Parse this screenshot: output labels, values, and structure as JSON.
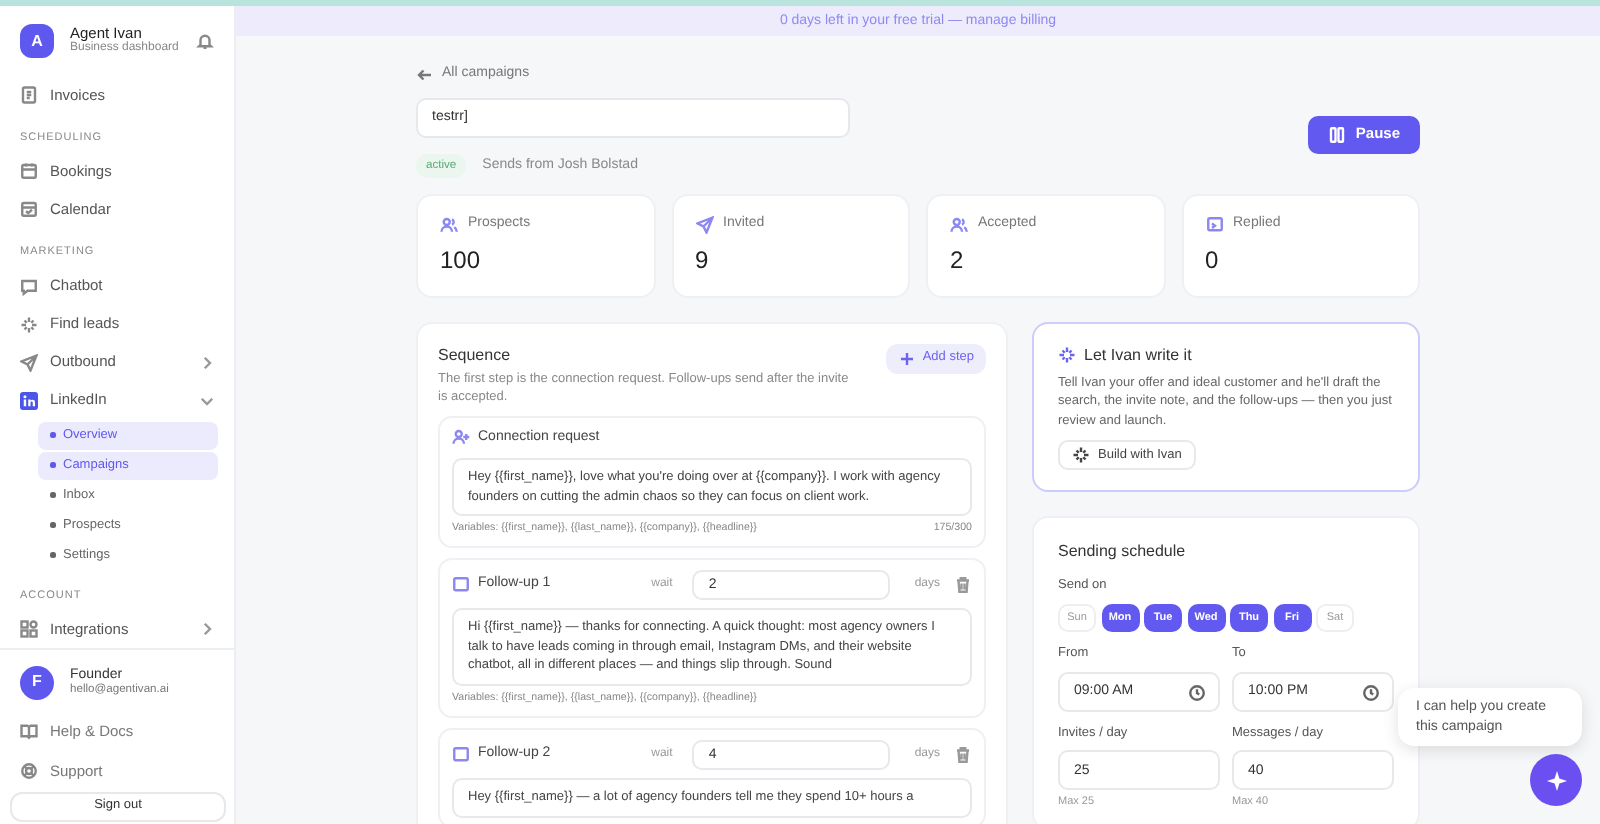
{
  "brand": {
    "avatar": "A",
    "name": "Agent Ivan",
    "subtitle": "Business dashboard"
  },
  "nav": [
    {
      "kind": "item",
      "label": "Invoices"
    },
    {
      "kind": "heading",
      "label": "SCHEDULING"
    },
    {
      "kind": "item",
      "label": "Bookings"
    },
    {
      "kind": "item",
      "label": "Calendar"
    },
    {
      "kind": "heading",
      "label": "MARKETING"
    },
    {
      "kind": "item",
      "label": "Chatbot"
    },
    {
      "kind": "item",
      "label": "Find leads"
    },
    {
      "kind": "item",
      "label": "Outbound",
      "expanded": false
    },
    {
      "kind": "item",
      "label": "LinkedIn",
      "expanded": true,
      "children": [
        {
          "label": "Overview",
          "selected": true
        },
        {
          "label": "Campaigns",
          "selected": true
        },
        {
          "label": "Inbox",
          "selected": false
        },
        {
          "label": "Prospects",
          "selected": false
        },
        {
          "label": "Settings",
          "selected": false
        }
      ]
    },
    {
      "kind": "heading",
      "label": "ACCOUNT"
    },
    {
      "kind": "item",
      "label": "Integrations",
      "expanded": false
    }
  ],
  "user": {
    "avatar": "F",
    "name": "Founder",
    "email": "hello@agentivan.ai"
  },
  "footer_links": [
    {
      "label": "Help & Docs"
    },
    {
      "label": "Support"
    }
  ],
  "sign_out": "Sign out",
  "banner": "0 days left in your free trial — manage billing",
  "back_link": "All campaigns",
  "campaign_name": "testrr]",
  "status": "active",
  "sender": "Sends from Josh Bolstad",
  "pause_button": "Pause",
  "stats": [
    {
      "label": "Prospects",
      "value": "100"
    },
    {
      "label": "Invited",
      "value": "9"
    },
    {
      "label": "Accepted",
      "value": "2"
    },
    {
      "label": "Replied",
      "value": "0"
    }
  ],
  "sequence": {
    "title": "Sequence",
    "description": "The first step is the connection request. Follow-ups send after the invite is accepted.",
    "add_button": "Add step",
    "steps": [
      {
        "kind": "connection",
        "title": "Connection request",
        "message": "Hey {{first_name}}, love what you're doing over at {{company}}. I work with agency founders on cutting the admin chaos so they can focus on client work.",
        "variables": "Variables: {{first_name}}, {{last_name}}, {{company}}, {{headline}}",
        "counter": "175/300"
      },
      {
        "kind": "followup",
        "title": "Follow-up 1",
        "wait_label": "wait",
        "wait": "2",
        "unit": "days",
        "message": "Hi {{first_name}} — thanks for connecting. A quick thought: most agency owners I talk to have leads coming in through email, Instagram DMs, and their website chatbot, all in different places — and things slip through. Sound",
        "variables": "Variables: {{first_name}}, {{last_name}}, {{company}}, {{headline}}"
      },
      {
        "kind": "followup",
        "title": "Follow-up 2",
        "wait_label": "wait",
        "wait": "4",
        "unit": "days",
        "message": "Hey {{first_name}} — a lot of agency founders tell me they spend 10+ hours a"
      }
    ]
  },
  "ai_card": {
    "title": "Let Ivan write it",
    "text": "Tell Ivan your offer and ideal customer and he'll draft the search, the invite note, and the follow-ups — then you just review and launch.",
    "button": "Build with Ivan"
  },
  "schedule": {
    "title": "Sending schedule",
    "send_on": "Send on",
    "days": [
      {
        "label": "Sun",
        "selected": false
      },
      {
        "label": "Mon",
        "selected": true
      },
      {
        "label": "Tue",
        "selected": true
      },
      {
        "label": "Wed",
        "selected": true
      },
      {
        "label": "Thu",
        "selected": true
      },
      {
        "label": "Fri",
        "selected": true
      },
      {
        "label": "Sat",
        "selected": false
      }
    ],
    "times": [
      {
        "label": "From",
        "value": "09:00 AM"
      },
      {
        "label": "To",
        "value": "10:00 PM"
      }
    ],
    "limits": [
      {
        "label": "Invites / day",
        "value": "25",
        "hint": "Max 25"
      },
      {
        "label": "Messages / day",
        "value": "40",
        "hint": "Max 40"
      }
    ]
  },
  "chat_bubble": "I can help you create this campaign"
}
